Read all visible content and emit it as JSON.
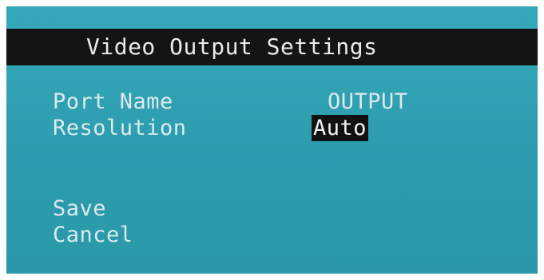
{
  "title": "Video Output Settings",
  "fields": [
    {
      "label": "Port Name",
      "value": "OUTPUT"
    },
    {
      "label": "Resolution",
      "value": "Auto"
    }
  ],
  "actions": {
    "save": "Save",
    "cancel": "Cancel"
  },
  "colors": {
    "background": "#2fa1b2",
    "titlebar": "#141414",
    "text": "#dde9ee",
    "highlight": "#111111"
  }
}
